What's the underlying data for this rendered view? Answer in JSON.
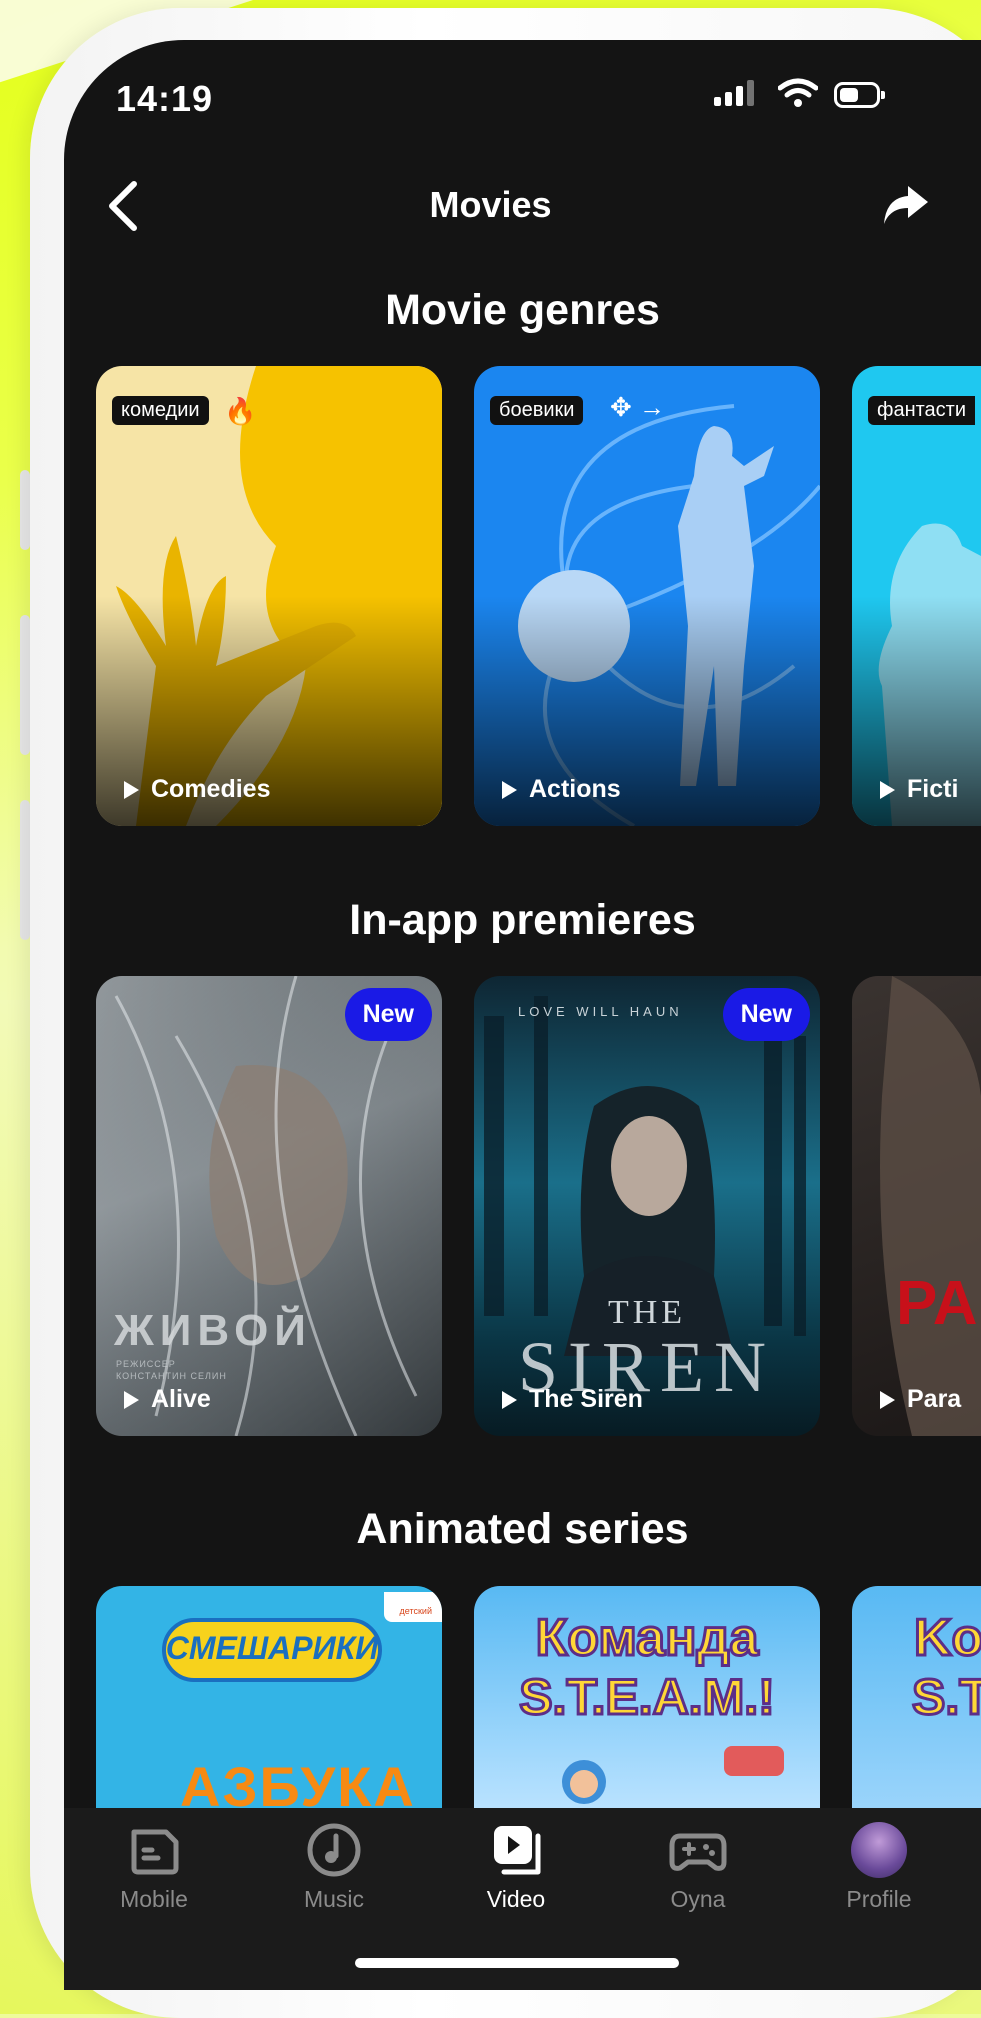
{
  "status_bar": {
    "time": "14:19"
  },
  "nav": {
    "title": "Movies"
  },
  "sections": [
    {
      "title": "Movie genres"
    },
    {
      "title": "In-app premieres"
    },
    {
      "title": "Animated series"
    }
  ],
  "genres": [
    {
      "tag": "комедии",
      "label": "Comedies",
      "color": "#f6c200"
    },
    {
      "tag": "боевики",
      "label": "Actions",
      "color": "#1b86f0"
    },
    {
      "tag": "фантасти",
      "label": "Ficti",
      "color": "#1fc8f0"
    }
  ],
  "premieres": [
    {
      "label": "Alive",
      "badge": "New",
      "poster_title": "ЖИВОЙ",
      "poster_credit": "РЕЖИССЕР\nКОНСТАНТИН СЕЛИН"
    },
    {
      "label": "The Siren",
      "badge": "New",
      "poster_tagline": "LOVE WILL HAUN",
      "poster_title_top": "THE",
      "poster_title": "SIREN"
    },
    {
      "label": "Para",
      "poster_title": "PAR"
    }
  ],
  "animated": [
    {
      "title": "СМЕШАРИКИ",
      "subtitle": "АЗБУКА",
      "tag": "детский"
    },
    {
      "title": "Команда",
      "subtitle": "S.T.E.A.M.!"
    },
    {
      "title": "Ko",
      "subtitle": "S.T"
    }
  ],
  "tabbar": {
    "items": [
      {
        "label": "Mobile",
        "icon": "sim-card-icon"
      },
      {
        "label": "Music",
        "icon": "music-disc-icon"
      },
      {
        "label": "Video",
        "icon": "video-play-icon",
        "active": true
      },
      {
        "label": "Oyna",
        "icon": "gamepad-icon"
      },
      {
        "label": "Profile",
        "icon": "avatar"
      }
    ]
  },
  "colors": {
    "accent_badge": "#1a1ae6",
    "screen_bg": "#141414",
    "background": "#e4ff1a"
  }
}
